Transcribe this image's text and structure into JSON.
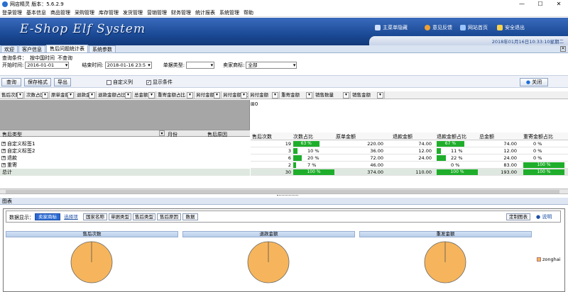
{
  "window": {
    "title": "网店精灵  版本：5.6.2.9",
    "min": "—",
    "max": "☐",
    "close": "✕"
  },
  "menu": [
    "登录管理",
    "基本信息",
    "商品管理",
    "采购管理",
    "库存管理",
    "发货管理",
    "营销管理",
    "财务管理",
    "统计报表",
    "系统管理",
    "帮助"
  ],
  "banner": {
    "logo": "E-Shop Elf System",
    "nav": [
      "主菜单隐藏",
      "意见反馈",
      "网站首页",
      "安全退出"
    ],
    "datetime": "2018年01月16日10:33:10星期二"
  },
  "tabs": [
    "欢迎",
    "客户信息",
    "售后问题统计表",
    "系统参数"
  ],
  "query": {
    "cond_label": "查询条件：",
    "cond1": "按中国时间",
    "cond2": "不查询"
  },
  "filters": {
    "start_label": "开始时间:",
    "start_value": "2016-01-01",
    "end_label": "结束时间:",
    "end_value": "2018-01-16 23:5",
    "type_label": "单据类型:",
    "type_value": "",
    "seller_label": "卖家商标:",
    "seller_value": "全部"
  },
  "toolbar": {
    "query": "查询",
    "save": "保存格式",
    "export": "导出",
    "custom_cols": "自定义列",
    "show_cond": "显示条件",
    "close": "关闭"
  },
  "columns": [
    "售后次数",
    "次数占比",
    "原单金额",
    "退款金额",
    "退款金额占比",
    "总金额",
    "重寄金额占比",
    "另付金额",
    "另付金额占比",
    "另付金额",
    "重寄金额",
    "销售数量",
    "销售金额"
  ],
  "pivot": {
    "row_field": "售后类型",
    "col_month": "月份",
    "col_reason": "售后原因",
    "filter_value": "0"
  },
  "row_labels": [
    "自定义标签1",
    "自定义标签2",
    "退款",
    "重寄"
  ],
  "total_label": "总计",
  "grid_headers": [
    "售后次数",
    "次数占比",
    "原单金额",
    "退款金额",
    "退款金额占比",
    "总金额",
    "重寄金额占比"
  ],
  "grid_rows": [
    {
      "count": "19",
      "ratio": "63 %",
      "ratio_v": 63,
      "orig": "220.00",
      "refund": "74.00",
      "refund_ratio": "67 %",
      "refund_ratio_v": 67,
      "total": "74.00",
      "resend_ratio": "0 %",
      "resend_ratio_v": 0
    },
    {
      "count": "3",
      "ratio": "10 %",
      "ratio_v": 10,
      "orig": "36.00",
      "refund": "12.00",
      "refund_ratio": "11 %",
      "refund_ratio_v": 11,
      "total": "12.00",
      "resend_ratio": "0 %",
      "resend_ratio_v": 0
    },
    {
      "count": "6",
      "ratio": "20 %",
      "ratio_v": 20,
      "orig": "72.00",
      "refund": "24.00",
      "refund_ratio": "22 %",
      "refund_ratio_v": 22,
      "total": "24.00",
      "resend_ratio": "0 %",
      "resend_ratio_v": 0
    },
    {
      "count": "2",
      "ratio": "7 %",
      "ratio_v": 7,
      "orig": "46.00",
      "refund": "",
      "refund_ratio": "0 %",
      "refund_ratio_v": 0,
      "total": "83.00",
      "resend_ratio": "100 %",
      "resend_ratio_v": 100
    },
    {
      "count": "30",
      "ratio": "100 %",
      "ratio_v": 100,
      "orig": "374.00",
      "refund": "110.00",
      "refund_ratio": "100 %",
      "refund_ratio_v": 100,
      "total": "193.00",
      "resend_ratio": "100 %",
      "resend_ratio_v": 100
    }
  ],
  "chart_section": {
    "title": "图表",
    "source_label": "数据显示：",
    "buttons": [
      "卖家商标",
      "选择项",
      "国家名称",
      "单据类型",
      "售后类型",
      "售后原因",
      "数据"
    ],
    "custom": "定制图表",
    "about": "说明"
  },
  "chart_data": [
    {
      "type": "pie",
      "title": "售后次数",
      "categories": [
        "zonghai"
      ],
      "values": [
        100
      ]
    },
    {
      "type": "pie",
      "title": "退款金额",
      "categories": [
        "zonghai"
      ],
      "values": [
        100
      ]
    },
    {
      "type": "pie",
      "title": "重发金额",
      "categories": [
        "zonghai"
      ],
      "values": [
        100
      ]
    }
  ],
  "legend": {
    "label": "zonghai",
    "color": "#f6b55c"
  }
}
